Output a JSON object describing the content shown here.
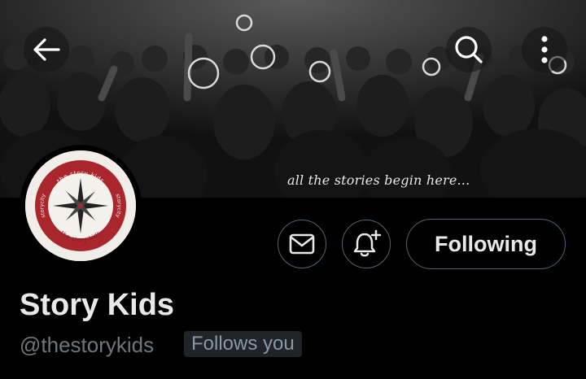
{
  "header": {
    "back_icon": "arrow-left-icon",
    "search_icon": "search-icon",
    "more_icon": "more-vertical-icon",
    "banner_caption": "all the stories begin here..."
  },
  "avatar": {
    "top_text": "the story kids",
    "bottom_text": "the story kids",
    "left_text": "storycity",
    "right_text": "storycity",
    "brand_color": "#a8262c"
  },
  "actions": {
    "message_icon": "envelope-icon",
    "notify_icon": "bell-plus-icon",
    "following_label": "Following"
  },
  "profile": {
    "display_name": "Story Kids",
    "handle": "@thestorykids",
    "follows_badge": "Follows you"
  },
  "colors": {
    "background": "#000000",
    "text_primary": "#e7e9ea",
    "text_secondary": "#71767b",
    "border": "#536471",
    "badge_bg": "#202327"
  }
}
